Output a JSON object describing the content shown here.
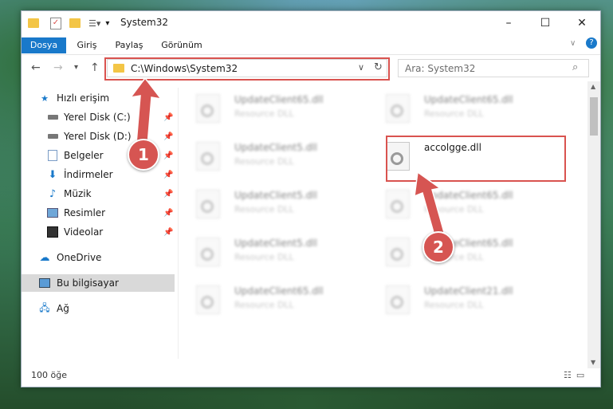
{
  "window": {
    "title": "System32",
    "controls": {
      "minimize": "–",
      "maximize": "☐",
      "close": "✕"
    }
  },
  "ribbon": {
    "tabs": [
      "Dosya",
      "Giriş",
      "Paylaş",
      "Görünüm"
    ],
    "active_tab": "Dosya"
  },
  "address_bar": {
    "path": "C:\\Windows\\System32",
    "search_placeholder": "Ara: System32"
  },
  "sidebar": {
    "quick_access": "Hızlı erişim",
    "items": [
      {
        "label": "Yerel Disk (C:)",
        "icon": "drive-icon"
      },
      {
        "label": "Yerel Disk (D:)",
        "icon": "drive-icon"
      },
      {
        "label": "Belgeler",
        "icon": "documents-icon"
      },
      {
        "label": "İndirmeler",
        "icon": "download-icon"
      },
      {
        "label": "Müzik",
        "icon": "music-icon"
      },
      {
        "label": "Resimler",
        "icon": "pictures-icon"
      },
      {
        "label": "Videolar",
        "icon": "video-icon"
      }
    ],
    "onedrive": "OneDrive",
    "this_pc": "Bu bilgisayar",
    "network": "Ağ"
  },
  "files": [
    {
      "name": "UpdateClient65.dll",
      "desc": "Resource DLL"
    },
    {
      "name": "UpdateClient65.dll",
      "desc": "Resource DLL"
    },
    {
      "name": "UpdateClient5.dll",
      "desc": "Resource DLL"
    },
    {
      "name": "accolgge.dll",
      "desc": ""
    },
    {
      "name": "UpdateClient5.dll",
      "desc": "Resource DLL"
    },
    {
      "name": "UpdateClient65.dll",
      "desc": "Resource DLL"
    },
    {
      "name": "UpdateClient5.dll",
      "desc": "Resource DLL"
    },
    {
      "name": "UpdateClient65.dll",
      "desc": "Resource DLL"
    },
    {
      "name": "UpdateClient65.dll",
      "desc": "Resource DLL"
    },
    {
      "name": "UpdateClient21.dll",
      "desc": "Resource DLL"
    }
  ],
  "status": {
    "count": "100 öğe"
  },
  "annotations": {
    "step1": "1",
    "step2": "2",
    "color": "#d9534f"
  }
}
